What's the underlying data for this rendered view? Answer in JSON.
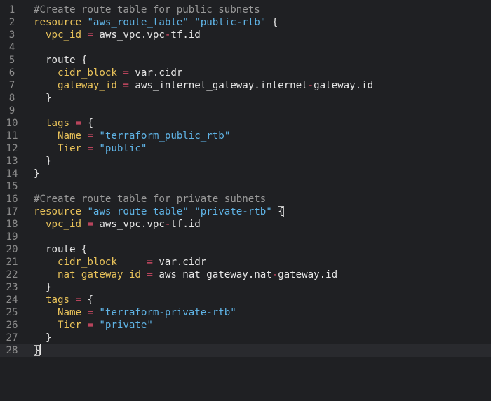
{
  "editor": {
    "language": "terraform",
    "lines": [
      {
        "n": "1",
        "tokens": [
          {
            "t": "  #Create route table for public subnets",
            "c": "cm"
          }
        ]
      },
      {
        "n": "2",
        "tokens": [
          {
            "t": "  resource ",
            "c": "kw"
          },
          {
            "t": "\"aws_route_table\"",
            "c": "str"
          },
          {
            "t": " ",
            "c": "txt"
          },
          {
            "t": "\"public-rtb\"",
            "c": "str"
          },
          {
            "t": " {",
            "c": "txt"
          }
        ]
      },
      {
        "n": "3",
        "tokens": [
          {
            "t": "    vpc_id",
            "c": "kw"
          },
          {
            "t": " = ",
            "c": "op"
          },
          {
            "t": "aws_vpc.vpc",
            "c": "txt"
          },
          {
            "t": "-",
            "c": "op"
          },
          {
            "t": "tf.id",
            "c": "txt"
          }
        ]
      },
      {
        "n": "4",
        "tokens": []
      },
      {
        "n": "5",
        "tokens": [
          {
            "t": "    route {",
            "c": "txt"
          }
        ]
      },
      {
        "n": "6",
        "tokens": [
          {
            "t": "      cidr_block",
            "c": "kw"
          },
          {
            "t": " = ",
            "c": "op"
          },
          {
            "t": "var.cidr",
            "c": "txt"
          }
        ]
      },
      {
        "n": "7",
        "tokens": [
          {
            "t": "      gateway_id",
            "c": "kw"
          },
          {
            "t": " = ",
            "c": "op"
          },
          {
            "t": "aws_internet_gateway.internet",
            "c": "txt"
          },
          {
            "t": "-",
            "c": "op"
          },
          {
            "t": "gateway.id",
            "c": "txt"
          }
        ]
      },
      {
        "n": "8",
        "tokens": [
          {
            "t": "    }",
            "c": "txt"
          }
        ]
      },
      {
        "n": "9",
        "tokens": []
      },
      {
        "n": "10",
        "tokens": [
          {
            "t": "    tags",
            "c": "kw"
          },
          {
            "t": " = ",
            "c": "op"
          },
          {
            "t": "{",
            "c": "txt"
          }
        ]
      },
      {
        "n": "11",
        "tokens": [
          {
            "t": "      Name",
            "c": "kw"
          },
          {
            "t": " = ",
            "c": "op"
          },
          {
            "t": "\"terraform_public_rtb\"",
            "c": "str"
          }
        ]
      },
      {
        "n": "12",
        "tokens": [
          {
            "t": "      Tier",
            "c": "kw"
          },
          {
            "t": " = ",
            "c": "op"
          },
          {
            "t": "\"public\"",
            "c": "str"
          }
        ]
      },
      {
        "n": "13",
        "tokens": [
          {
            "t": "    }",
            "c": "txt"
          }
        ]
      },
      {
        "n": "14",
        "tokens": [
          {
            "t": "  }",
            "c": "txt"
          }
        ]
      },
      {
        "n": "15",
        "tokens": []
      },
      {
        "n": "16",
        "tokens": [
          {
            "t": "  #Create route table for private subnets",
            "c": "cm"
          }
        ]
      },
      {
        "n": "17",
        "tokens": [
          {
            "t": "  resource ",
            "c": "kw"
          },
          {
            "t": "\"aws_route_table\"",
            "c": "str"
          },
          {
            "t": " ",
            "c": "txt"
          },
          {
            "t": "\"private-rtb\"",
            "c": "str"
          },
          {
            "t": " ",
            "c": "txt"
          },
          {
            "t": "{",
            "c": "txt",
            "box": true
          }
        ]
      },
      {
        "n": "18",
        "tokens": [
          {
            "t": "    vpc_id",
            "c": "kw"
          },
          {
            "t": " = ",
            "c": "op"
          },
          {
            "t": "aws_vpc.vpc",
            "c": "txt"
          },
          {
            "t": "-",
            "c": "op"
          },
          {
            "t": "tf.id",
            "c": "txt"
          }
        ]
      },
      {
        "n": "19",
        "tokens": []
      },
      {
        "n": "20",
        "tokens": [
          {
            "t": "    route {",
            "c": "txt"
          }
        ]
      },
      {
        "n": "21",
        "tokens": [
          {
            "t": "      cidr_block",
            "c": "kw"
          },
          {
            "t": "     = ",
            "c": "op"
          },
          {
            "t": "var.cidr",
            "c": "txt"
          }
        ]
      },
      {
        "n": "22",
        "tokens": [
          {
            "t": "      nat_gateway_id",
            "c": "kw"
          },
          {
            "t": " = ",
            "c": "op"
          },
          {
            "t": "aws_nat_gateway.nat",
            "c": "txt"
          },
          {
            "t": "-",
            "c": "op"
          },
          {
            "t": "gateway.id",
            "c": "txt"
          }
        ]
      },
      {
        "n": "23",
        "tokens": [
          {
            "t": "    }",
            "c": "txt"
          }
        ]
      },
      {
        "n": "24",
        "tokens": [
          {
            "t": "    tags",
            "c": "kw"
          },
          {
            "t": " = ",
            "c": "op"
          },
          {
            "t": "{",
            "c": "txt"
          }
        ]
      },
      {
        "n": "25",
        "tokens": [
          {
            "t": "      Name",
            "c": "kw"
          },
          {
            "t": " = ",
            "c": "op"
          },
          {
            "t": "\"terraform-private-rtb\"",
            "c": "str"
          }
        ]
      },
      {
        "n": "26",
        "tokens": [
          {
            "t": "      Tier",
            "c": "kw"
          },
          {
            "t": " = ",
            "c": "op"
          },
          {
            "t": "\"private\"",
            "c": "str"
          }
        ]
      },
      {
        "n": "27",
        "tokens": [
          {
            "t": "    }",
            "c": "txt"
          }
        ]
      },
      {
        "n": "28",
        "tokens": [
          {
            "t": "  ",
            "c": "txt"
          },
          {
            "t": "}",
            "c": "txt",
            "box": true,
            "cursor": true
          }
        ],
        "current": true
      }
    ],
    "colors": {
      "background": "#1f2023",
      "keyword": "#e8c25a",
      "string": "#5fb3e5",
      "operator": "#e84f6e",
      "comment": "#9a9a9a",
      "text": "#e6e6e6",
      "line_number": "#8c8c8c"
    }
  }
}
